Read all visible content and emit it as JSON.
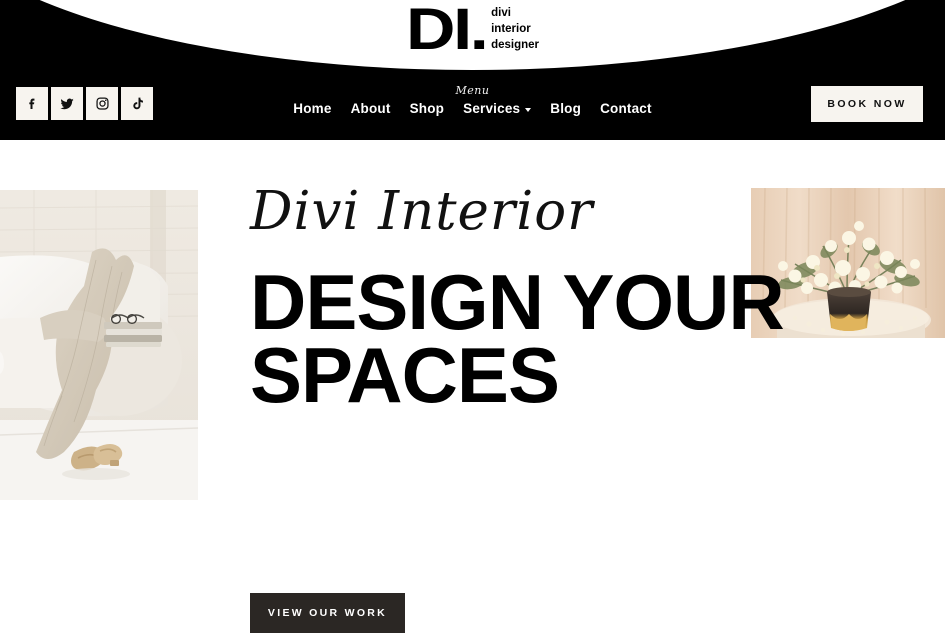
{
  "site": {
    "brand_mark": "DI.",
    "brand_words": [
      "divi",
      "interior",
      "designer"
    ]
  },
  "header": {
    "background_color": "#000000",
    "socials": [
      {
        "name": "facebook",
        "icon": "facebook-icon",
        "label": "Facebook"
      },
      {
        "name": "twitter",
        "icon": "twitter-icon",
        "label": "Twitter"
      },
      {
        "name": "instagram",
        "icon": "instagram-icon",
        "label": "Instagram"
      },
      {
        "name": "tiktok",
        "icon": "tiktok-icon",
        "label": "TikTok"
      }
    ],
    "nav_script_label": "Menu",
    "nav": [
      {
        "label": "Home",
        "has_dropdown": false
      },
      {
        "label": "About",
        "has_dropdown": false
      },
      {
        "label": "Shop",
        "has_dropdown": false
      },
      {
        "label": "Services",
        "has_dropdown": true
      },
      {
        "label": "Blog",
        "has_dropdown": false
      },
      {
        "label": "Contact",
        "has_dropdown": false
      }
    ],
    "book_button_label": "BOOK NOW",
    "book_button_bg": "#f7f4ef"
  },
  "hero": {
    "script_heading": "Divi Interior",
    "title_line1": "DESIGN YOUR",
    "title_line2": "SPACES",
    "cta_label": "VIEW OUR WORK",
    "cta_bg": "#2b2724",
    "left_image_alt": "white sofa with linen throw and sandals",
    "right_image_alt": "floral arrangement in vase on marble table"
  }
}
